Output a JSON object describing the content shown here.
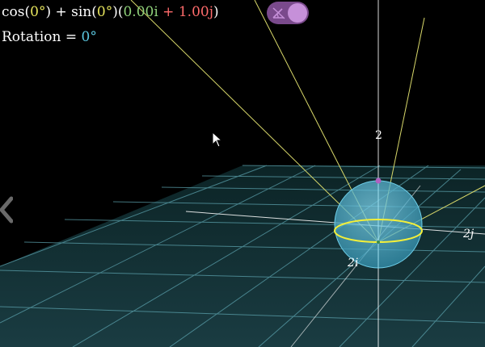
{
  "formula": {
    "cos_fn": "cos(",
    "cos_angle": "0°",
    "plus1": ") + sin(",
    "sin_angle": "0°",
    "open_paren": ")(",
    "i_term": "0.00i",
    "plus2": " + ",
    "j_term": "1.00j",
    "close_paren": ")"
  },
  "rotation": {
    "label": "Rotation = ",
    "value": "0°"
  },
  "axes": {
    "k_label": "2",
    "j_label": "2j",
    "i_label": "2i"
  },
  "toggle": {
    "state": "on",
    "icon": "angle-icon"
  },
  "colors": {
    "grid": "#5fa7b3",
    "sphere": "#4fb7d6",
    "equator": "#f2ef3a",
    "ray": "#d8d86a",
    "toggle_track": "#7a4a8c",
    "toggle_knob": "#c690d9"
  }
}
